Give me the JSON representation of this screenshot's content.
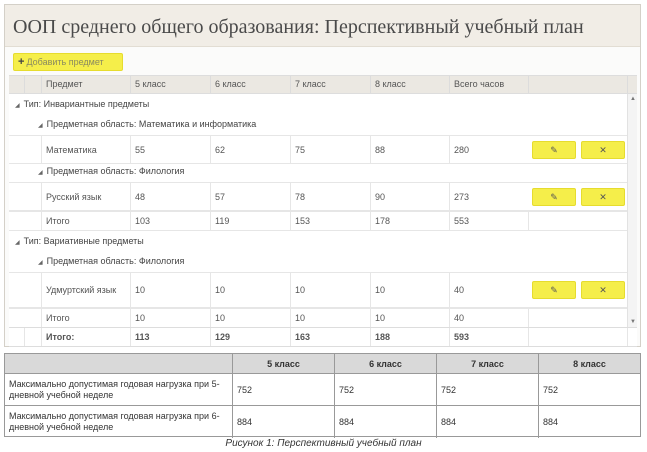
{
  "title": "ООП среднего общего образования: Перспективный учебный план",
  "add_button": {
    "icon": "plus-icon",
    "label": "Добавить предмет"
  },
  "columns": [
    "Предмет",
    "5 класс",
    "6 класс",
    "7 класс",
    "8 класс",
    "Всего часов"
  ],
  "groups": [
    {
      "label": "Тип: Инвариантные предметы"
    },
    {
      "label": "Предметная область: Математика и информатика"
    },
    {
      "label": "Предметная область: Филология"
    },
    {
      "label": "Тип: Вариативные предметы"
    },
    {
      "label": "Предметная область: Филология"
    }
  ],
  "rows": [
    {
      "subject": "Математика",
      "c5": "55",
      "c6": "62",
      "c7": "75",
      "c8": "88",
      "total": "280"
    },
    {
      "subject": "Русский язык",
      "c5": "48",
      "c6": "57",
      "c7": "78",
      "c8": "90",
      "total": "273"
    },
    {
      "subject": "Итого",
      "c5": "103",
      "c6": "119",
      "c7": "153",
      "c8": "178",
      "total": "553"
    },
    {
      "subject": "Удмуртский язык",
      "c5": "10",
      "c6": "10",
      "c7": "10",
      "c8": "10",
      "total": "40"
    },
    {
      "subject": "Итого",
      "c5": "10",
      "c6": "10",
      "c7": "10",
      "c8": "10",
      "total": "40"
    }
  ],
  "row_buttons": {
    "edit_icon": "pencil-icon",
    "edit_glyph": "✎",
    "delete_icon": "close-icon",
    "delete_glyph": "✕"
  },
  "grand_total": {
    "label": "Итого:",
    "c5": "113",
    "c6": "129",
    "c7": "163",
    "c8": "188",
    "total": "593"
  },
  "load_table": {
    "headers": [
      "5 класс",
      "6 класс",
      "7 класс",
      "8 класс"
    ],
    "rows": [
      {
        "label": "Максимально допустимая годовая нагрузка при 5-дневной учебной неделе",
        "v": [
          "752",
          "752",
          "752",
          "752"
        ]
      },
      {
        "label": "Максимально допустимая годовая нагрузка при 6-дневной учебной неделе",
        "v": [
          "884",
          "884",
          "884",
          "884"
        ]
      }
    ]
  },
  "caption": "Рисунок 1: Перспективный учебный план",
  "colors": {
    "accent": "#f5ee4a",
    "header_bg": "#f1ede6"
  }
}
